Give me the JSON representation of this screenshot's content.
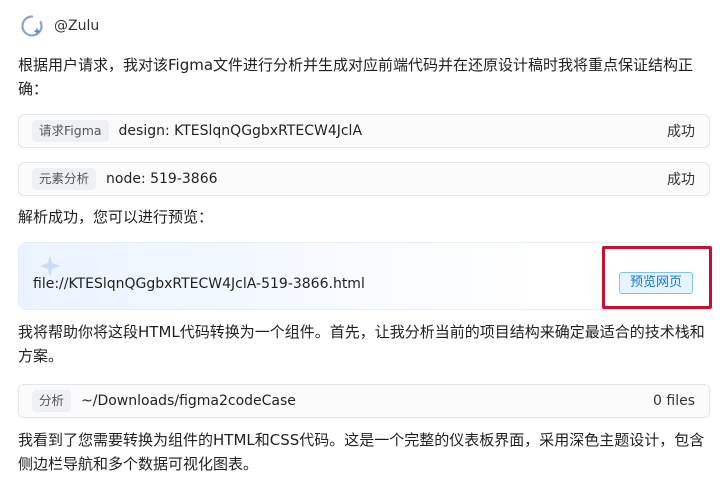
{
  "header": {
    "username": "@Zulu",
    "avatar_icon": "zulu-logo-icon"
  },
  "intro_text": "根据用户请求，我对该Figma文件进行分析并生成对应前端代码并在还原设计稿时我将重点保证结构正确：",
  "tool_calls": [
    {
      "tag": "请求Figma",
      "detail": "design: KTESlqnQGgbxRTECW4JclA",
      "status": "成功"
    },
    {
      "tag": "元素分析",
      "detail": "node: 519-3866",
      "status": "成功"
    }
  ],
  "parse_success_text": "解析成功，您可以进行预览：",
  "preview": {
    "file_path": "file://KTESlqnQGgbxRTECW4JclA-519-3866.html",
    "button_label": "预览网页",
    "sparkle_icon": "sparkle-icon",
    "highlight_color": "#c8102e"
  },
  "convert_text": "我将帮助你将这段HTML代码转换为一个组件。首先，让我分析当前的项目结构来确定最适合的技术栈和方案。",
  "analyze_call": {
    "tag": "分析",
    "detail": "~/Downloads/figma2codeCase",
    "status": "0 files"
  },
  "final_text": "我看到了您需要转换为组件的HTML和CSS代码。这是一个完整的仪表板界面，采用深色主题设计，包含侧边栏导航和多个数据可视化图表。",
  "colors": {
    "accent": "#1677c9",
    "button_bg": "#e6f4ff",
    "button_border": "#7fc4f0"
  }
}
